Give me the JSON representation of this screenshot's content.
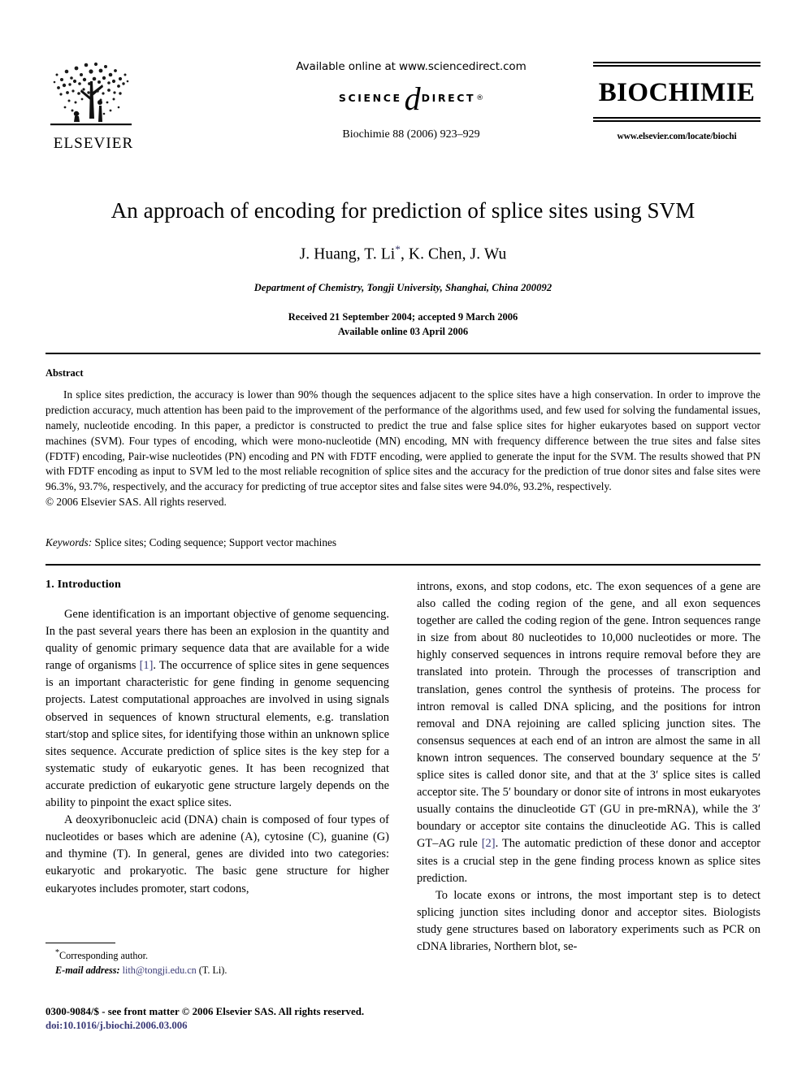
{
  "masthead": {
    "publisher_logo_name": "ELSEVIER",
    "available_online": "Available online at www.sciencedirect.com",
    "sciencedirect_science": "SCIENCE",
    "sciencedirect_d": "d",
    "sciencedirect_direct": "DIRECT",
    "sciencedirect_reg": "®",
    "citation": "Biochimie 88 (2006) 923–929",
    "journal_name": "BIOCHIMIE",
    "journal_url": "www.elsevier.com/locate/biochi"
  },
  "title_block": {
    "title": "An approach of encoding for prediction of splice sites using SVM",
    "authors": "J. Huang, T. Li",
    "authors_star": "*",
    "authors_rest": ", K. Chen, J. Wu",
    "affiliation": "Department of Chemistry, Tongji University, Shanghai, China 200092",
    "received": "Received 21 September 2004; accepted 9 March 2006",
    "available_online": "Available online 03 April 2006"
  },
  "abstract": {
    "heading": "Abstract",
    "body": "In splice sites prediction, the accuracy is lower than 90% though the sequences adjacent to the splice sites have a high conservation. In order to improve the prediction accuracy, much attention has been paid to the improvement of the performance of the algorithms used, and few used for solving the fundamental issues, namely, nucleotide encoding. In this paper, a predictor is constructed to predict the true and false splice sites for higher eukaryotes based on support vector machines (SVM). Four types of encoding, which were mono-nucleotide (MN) encoding, MN with frequency difference between the true sites and false sites (FDTF) encoding, Pair-wise nucleotides (PN) encoding and PN with FDTF encoding, were applied to generate the input for the SVM. The results showed that PN with FDTF encoding as input to SVM led to the most reliable recognition of splice sites and the accuracy for the prediction of true donor sites and false sites were 96.3%, 93.7%, respectively, and the accuracy for predicting of true acceptor sites and false sites were 94.0%, 93.2%, respectively.",
    "copyright": "© 2006 Elsevier SAS. All rights reserved.",
    "keywords_label": "Keywords:",
    "keywords_value": "Splice sites; Coding sequence; Support vector machines"
  },
  "introduction": {
    "heading": "1. Introduction",
    "left_p1_a": "Gene identification is an important objective of genome sequencing. In the past several years there has been an explosion in the quantity and quality of genomic primary sequence data that are available for a wide range of organisms ",
    "left_p1_cite": "[1]",
    "left_p1_b": ". The occurrence of splice sites in gene sequences is an important characteristic for gene finding in genome sequencing projects. Latest computational approaches are involved in using signals observed in sequences of known structural elements, e.g. translation start/stop and splice sites, for identifying those within an unknown splice sites sequence. Accurate prediction of splice sites is the key step for a systematic study of eukaryotic genes. It has been recognized that accurate prediction of eukaryotic gene structure largely depends on the ability to pinpoint the exact splice sites.",
    "left_p2": "A deoxyribonucleic acid (DNA) chain is composed of four types of nucleotides or bases which are adenine (A), cytosine (C), guanine (G) and thymine (T). In general, genes are divided into two categories: eukaryotic and prokaryotic. The basic gene structure for higher eukaryotes includes promoter, start codons,",
    "right_p1_a": "introns, exons, and stop codons, etc. The exon sequences of a gene are also called the coding region of the gene, and all exon sequences together are called the coding region of the gene. Intron sequences range in size from about 80 nucleotides to 10,000 nucleotides or more. The highly conserved sequences in introns require removal before they are translated into protein. Through the processes of transcription and translation, genes control the synthesis of proteins. The process for intron removal is called DNA splicing, and the positions for intron removal and DNA rejoining are called splicing junction sites. The consensus sequences at each end of an intron are almost the same in all known intron sequences. The conserved boundary sequence at the 5′ splice sites is called donor site, and that at the 3′ splice sites is called acceptor site. The 5′ boundary or donor site of introns in most eukaryotes usually contains the dinucleotide GT (GU in pre-mRNA), while the 3′ boundary or acceptor site contains the dinucleotide AG. This is called GT–AG rule ",
    "right_p1_cite": "[2]",
    "right_p1_b": ". The automatic prediction of these donor and acceptor sites is a crucial step in the gene finding process known as splice sites prediction.",
    "right_p2": "To locate exons or introns, the most important step is to detect splicing junction sites including donor and acceptor sites. Biologists study gene structures based on laboratory experiments such as PCR on cDNA libraries, Northern blot, se-"
  },
  "footnote": {
    "star": "*",
    "corresponding": "Corresponding author.",
    "email_label": "E-mail address:",
    "email_value": "lith@tongji.edu.cn",
    "email_suffix": "(T. Li)."
  },
  "footer": {
    "front_matter": "0300-9084/$ - see front matter © 2006 Elsevier SAS. All rights reserved.",
    "doi": "doi:10.1016/j.biochi.2006.03.006"
  },
  "colors": {
    "link": "#3a3a77",
    "text": "#000000",
    "background": "#ffffff"
  }
}
